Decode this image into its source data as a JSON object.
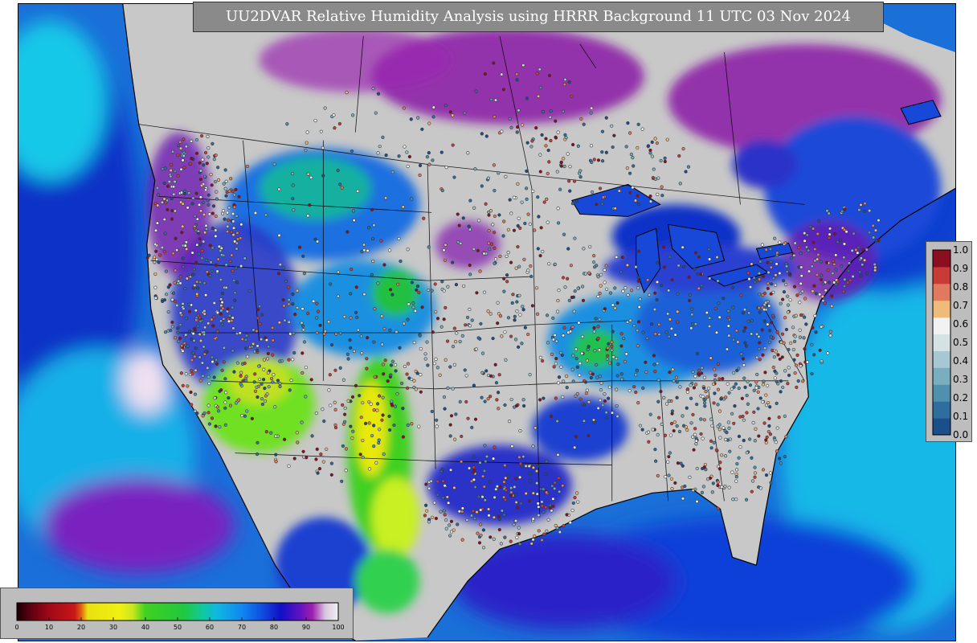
{
  "title": "UU2DVAR Relative Humidity Analysis using HRRR Background 11 UTC 03 Nov 2024",
  "colors": {
    "background_gray": "#c9c9c9",
    "ocean_blue": "#1a7fe0",
    "deep_blue": "#1030c8",
    "purple": "#8a1aa6",
    "green": "#2cc432",
    "yellow": "#ecf01a",
    "cyan": "#18c8e8"
  },
  "rh_colorbar": {
    "ticks": [
      "0",
      "10",
      "20",
      "30",
      "40",
      "50",
      "60",
      "70",
      "80",
      "90",
      "100"
    ],
    "min": 0,
    "max": 100,
    "stops": [
      {
        "v": 0,
        "c": "#1a0000"
      },
      {
        "v": 4,
        "c": "#5a0010"
      },
      {
        "v": 10,
        "c": "#a00818"
      },
      {
        "v": 18,
        "c": "#c81818"
      },
      {
        "v": 20,
        "c": "#e06010"
      },
      {
        "v": 22,
        "c": "#e8e010"
      },
      {
        "v": 32,
        "c": "#f0f010"
      },
      {
        "v": 36,
        "c": "#c8e820"
      },
      {
        "v": 40,
        "c": "#40d020"
      },
      {
        "v": 52,
        "c": "#20c840"
      },
      {
        "v": 58,
        "c": "#10c8a0"
      },
      {
        "v": 62,
        "c": "#10b8e0"
      },
      {
        "v": 70,
        "c": "#1088f0"
      },
      {
        "v": 76,
        "c": "#1050e0"
      },
      {
        "v": 82,
        "c": "#1010c8"
      },
      {
        "v": 88,
        "c": "#6010c0"
      },
      {
        "v": 92,
        "c": "#a020b0"
      },
      {
        "v": 96,
        "c": "#d8c8e0"
      },
      {
        "v": 100,
        "c": "#f0f0f0"
      }
    ]
  },
  "obs_colorbar": {
    "ticks": [
      "0.0",
      "0.1",
      "0.2",
      "0.3",
      "0.4",
      "0.5",
      "0.6",
      "0.7",
      "0.8",
      "0.9",
      "1.0"
    ],
    "min": 0,
    "max": 1,
    "segments": [
      "#1a4f8a",
      "#2e6e9e",
      "#4e90ae",
      "#78aebe",
      "#a6c8d2",
      "#d4e2e6",
      "#f2f2f2",
      "#f0ba7a",
      "#e07a5e",
      "#c83c38",
      "#8a1020"
    ]
  }
}
